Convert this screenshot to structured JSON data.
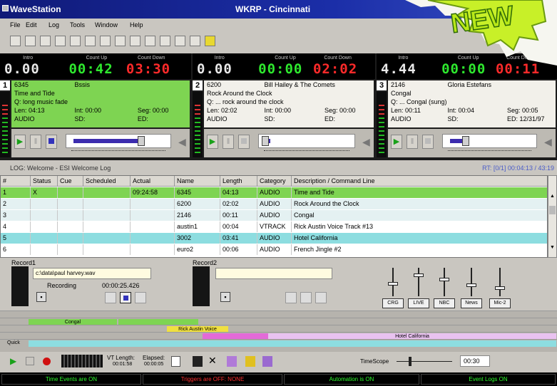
{
  "app": {
    "title": "WaveStation",
    "window_title": "WKRP - Cincinnati"
  },
  "menu": [
    "File",
    "Edit",
    "Log",
    "Tools",
    "Window",
    "Help"
  ],
  "badge": "NEW",
  "players": [
    {
      "num": "1",
      "labels": [
        "Intro",
        "Count Up",
        "Count Down"
      ],
      "clocks": [
        "0.00",
        "00:42",
        "03:30"
      ],
      "cart": "6345",
      "artist": "Bssis",
      "title": "Time and Tide",
      "outcue": "Q: long music fade",
      "len": "Len: 04:13",
      "int": "Int: 00:00",
      "seg": "Seg: 00:00",
      "type": "AUDIO",
      "sd": "SD:",
      "ed": "ED:",
      "fill": 0.75,
      "color": "#7ed452"
    },
    {
      "num": "2",
      "labels": [
        "Intro",
        "Count Up",
        "Count Down"
      ],
      "clocks": [
        "0.00",
        "00:00",
        "02:02"
      ],
      "cart": "6200",
      "artist": "Bill Hailey & The Comets",
      "title": "Rock Around the Clock",
      "outcue": "Q: ... rock around the clock",
      "len": "Len: 02:02",
      "int": "Int: 00:00",
      "seg": "Seg: 00:00",
      "type": "AUDIO",
      "sd": "SD:",
      "ed": "ED:",
      "fill": 0.0,
      "color": "#f2f0ea"
    },
    {
      "num": "3",
      "labels": [
        "Intro",
        "Count Up",
        "Count Down"
      ],
      "clocks": [
        "4.44",
        "00:00",
        "00:11"
      ],
      "cart": "2146",
      "artist": "Gloria Estefans",
      "title": "Congal",
      "outcue": "Q: ... Congal (sung)",
      "len": "Len: 00:11",
      "int": "Int: 00:04",
      "seg": "Seg: 00:05",
      "type": "AUDIO",
      "sd": "SD:",
      "ed": "ED: 12/31/97",
      "fill": 0.2,
      "color": "#f2f0ea"
    }
  ],
  "log": {
    "title": "LOG: Welcome - ESI Welcome Log",
    "right_info": "RT: [0/1] 00:04:13 / 43:19",
    "headers": [
      "#",
      "Status",
      "Cue",
      "Scheduled",
      "Actual",
      "Name",
      "Length",
      "Category",
      "Description / Command Line"
    ],
    "rows": [
      [
        "1",
        "X",
        "",
        "",
        "09:24:58",
        "6345",
        "04:13",
        "AUDIO",
        "Time and Tide"
      ],
      [
        "2",
        "",
        "",
        "",
        "",
        "6200",
        "02:02",
        "AUDIO",
        "Rock Around the Clock"
      ],
      [
        "3",
        "",
        "",
        "",
        "",
        "2146",
        "00:11",
        "AUDIO",
        "Congal"
      ],
      [
        "4",
        "",
        "",
        "",
        "",
        "austin1",
        "00:04",
        "VTRACK",
        "Rick Austin Voice Track #13"
      ],
      [
        "5",
        "",
        "",
        "",
        "",
        "3002",
        "03:41",
        "AUDIO",
        "Hotel California"
      ],
      [
        "6",
        "",
        "",
        "",
        "",
        "euro2",
        "00:06",
        "AUDIO",
        "French Jingle #2"
      ]
    ]
  },
  "record1": {
    "label": "Record1",
    "path": "c:\\data\\paul harvey.wav",
    "status": "Recording",
    "time": "00:00:25.426"
  },
  "record2": {
    "label": "Record2",
    "path": ""
  },
  "mixer": [
    "CRG",
    "LIVE",
    "NBC",
    "News",
    "Mic-2"
  ],
  "timeline": {
    "blocks": [
      "Congal",
      "Rick Austin Voice",
      "Hotel California"
    ]
  },
  "bottom": {
    "vt_length": "VT Length:",
    "elapsed": "Elapsed:",
    "vt_val": "00:01:58",
    "el_val": "00:00:05",
    "timescope": "TimeScope",
    "scope_val": "00:30",
    "quick": "Quick"
  },
  "status": [
    "Time Events are ON",
    "Triggers are OFF: NONE",
    "Automation is ON",
    "Event Logs ON"
  ]
}
